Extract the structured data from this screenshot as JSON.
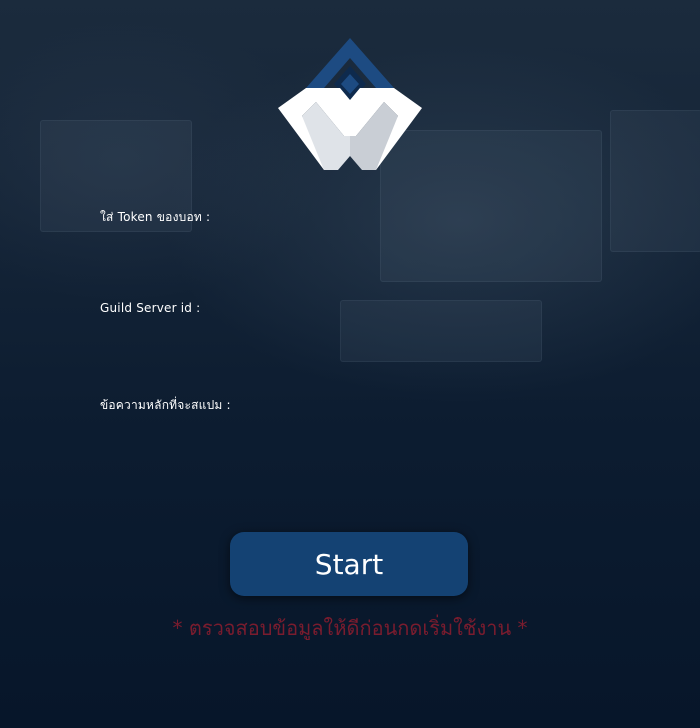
{
  "form": {
    "token_label": "ใส่ Token ของบอท :",
    "token_value": "",
    "guild_label": "Guild Server id :",
    "guild_value": "",
    "message_label": "ข้อความหลักที่จะสแปม :",
    "message_value": ""
  },
  "start_button": {
    "label": "Start"
  },
  "warning_text": "* ตรวจสอบข้อมูลให้ดีก่อนกดเริ่มใช้งาน *",
  "colors": {
    "button_bg": "#144273",
    "warning": "#7a1c2e",
    "logo_blue": "#1d4b82",
    "logo_white": "#ffffff"
  },
  "icons": {
    "logo": "brand-logo-icon"
  }
}
